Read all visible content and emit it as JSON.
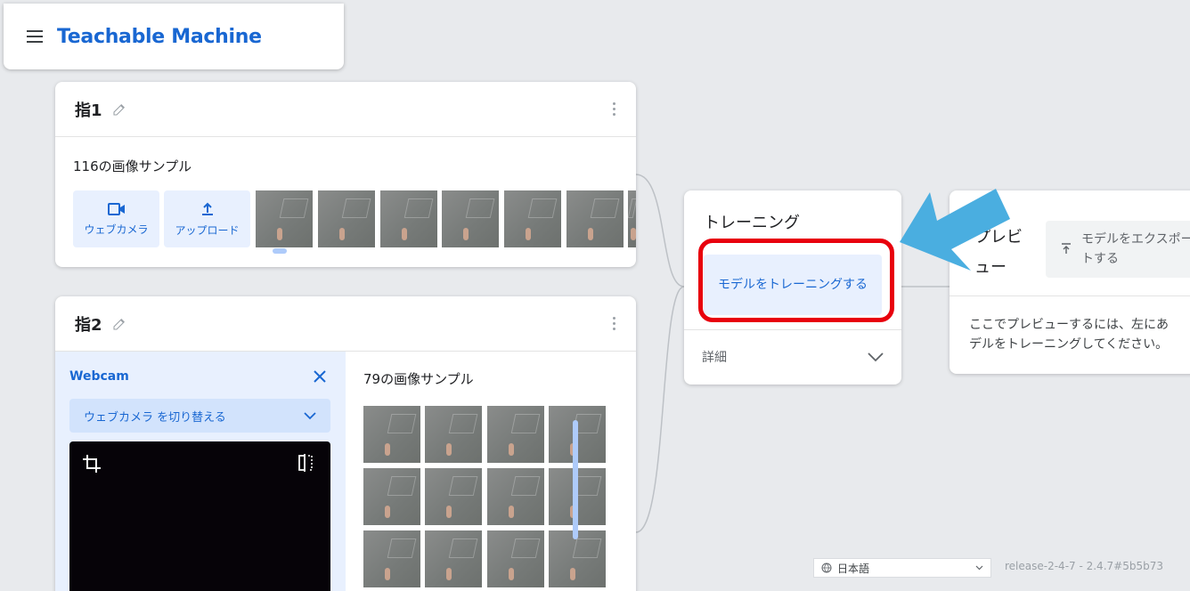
{
  "header": {
    "title": "Teachable Machine"
  },
  "classes": [
    {
      "name": "指1",
      "sample_count_label": "116の画像サンプル",
      "sources": {
        "webcam_label": "ウェブカメラ",
        "upload_label": "アップロード"
      },
      "thumbnail_count": 6
    },
    {
      "name": "指2",
      "sample_count_label": "79の画像サンプル",
      "webcam_panel": {
        "title": "Webcam",
        "switch_label": "ウェブカメラ を切り替える"
      }
    }
  ],
  "training": {
    "title": "トレーニング",
    "train_button": "モデルをトレーニングする",
    "advanced_label": "詳細"
  },
  "preview": {
    "title": "プレビュー",
    "title_visible": "プレビ ュー",
    "export_button": "モデルをエクスポートする",
    "hint": "ここでプレビューするには、左にあるモデルをトレーニングしてください。",
    "hint_visible_line1": "ここでプレビューするには、左にあ",
    "hint_visible_line2": "デルをトレーニングしてください。"
  },
  "footer": {
    "language": "日本語",
    "release": "release-2-4-7 - 2.4.7#5b5b73"
  },
  "colors": {
    "accent": "#1967d2",
    "highlight_box": "#e8000d",
    "annotation_arrow": "#4aaee0",
    "background": "#e8eaed"
  },
  "icons": [
    "menu-icon",
    "pencil-icon",
    "kebab-icon",
    "videocam-icon",
    "upload-icon",
    "close-icon",
    "chevron-down-icon",
    "crop-icon",
    "flip-icon",
    "globe-icon",
    "export-icon"
  ]
}
